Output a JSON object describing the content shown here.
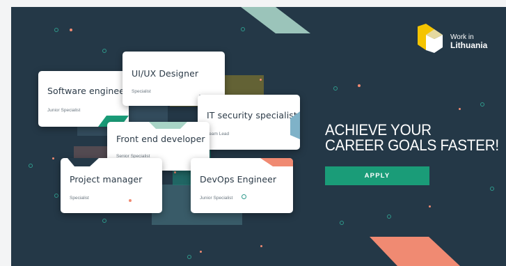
{
  "logo": {
    "line1": "Work in",
    "line2": "Lithuania"
  },
  "headline": {
    "line1": "ACHIEVE YOUR",
    "line2": "CAREER GOALS FASTER!"
  },
  "apply_label": "APPLY",
  "cards": [
    {
      "title": "Software engineer",
      "level": "Junior Specialist"
    },
    {
      "title": "UI/UX Designer",
      "level": "Specialist"
    },
    {
      "title": "IT security specialist",
      "level": "Team Lead"
    },
    {
      "title": "Front end developer",
      "level": "Senior Specialist"
    },
    {
      "title": "Project manager",
      "level": "Specialist"
    },
    {
      "title": "DevOps Engineer",
      "level": "Junior Specialist"
    }
  ],
  "colors": {
    "background": "#243847",
    "accent_green": "#1a9c78",
    "accent_salmon": "#f08a72",
    "accent_mint": "#a8d4c6",
    "logo_yellow": "#f5c400",
    "text_dark": "#2b3a47"
  }
}
